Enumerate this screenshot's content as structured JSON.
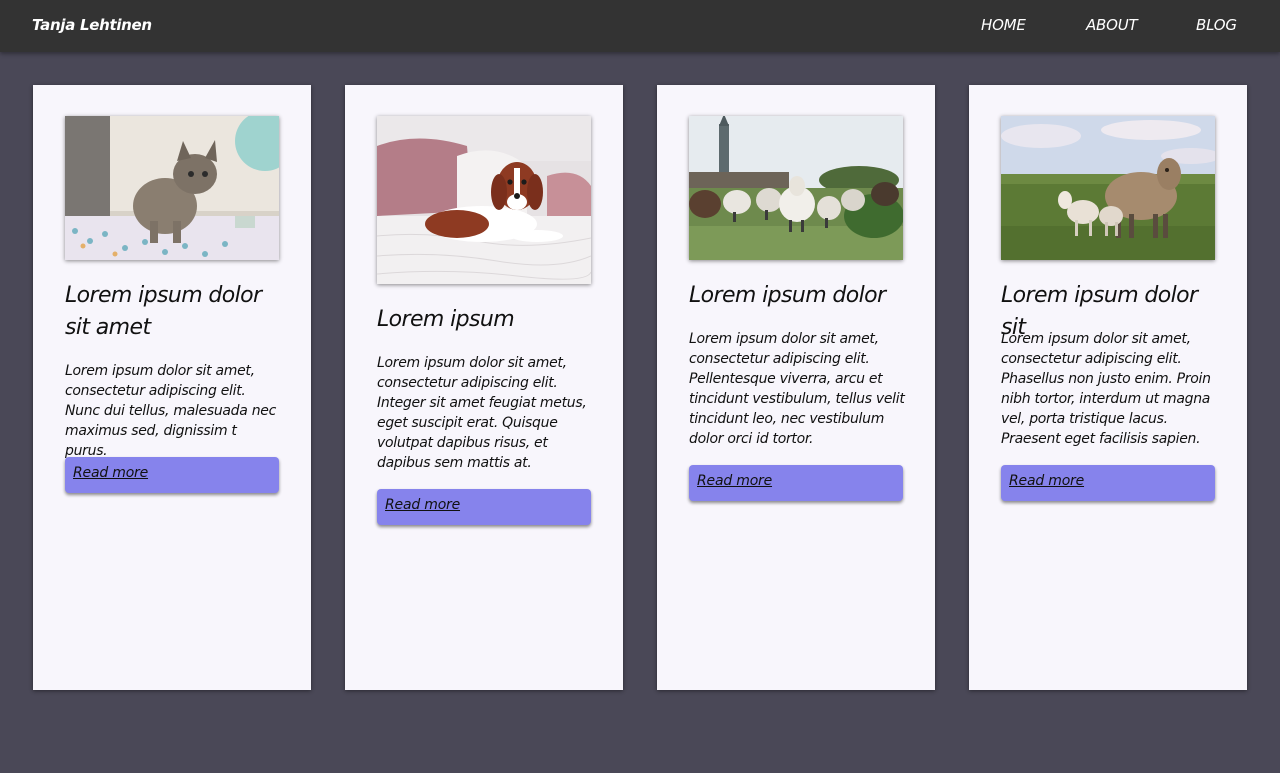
{
  "header": {
    "brand": "Tanja Lehtinen",
    "nav": [
      "HOME",
      "ABOUT",
      "BLOG"
    ]
  },
  "cards": [
    {
      "image": "kitten-photo",
      "title": "Lorem ipsum dolor sit amet",
      "text": "Lorem ipsum dolor sit amet, consectetur adipiscing elit. Nunc dui tellus, malesuada nec maximus sed, dignissim t purus.",
      "button": "Read more"
    },
    {
      "image": "dog-photo",
      "title": "Lorem ipsum",
      "text": "Lorem ipsum dolor sit amet, consectetur adipiscing elit. Integer sit amet feugiat metus, eget suscipit erat. Quisque volutpat dapibus risus, et dapibus sem mattis at.",
      "button": "Read more"
    },
    {
      "image": "sheep-flock-photo",
      "title": "Lorem ipsum dolor",
      "text": "Lorem ipsum dolor sit amet, consectetur adipiscing elit. Pellentesque viverra, arcu et tincidunt vestibulum, tellus velit tincidunt leo, nec vestibulum dolor orci id tortor.",
      "button": "Read more"
    },
    {
      "image": "sheep-lambs-photo",
      "title": "Lorem ipsum dolor sit",
      "text": "Lorem ipsum dolor sit amet, consectetur adipiscing elit. Phasellus non justo enim. Proin nibh tortor, interdum ut magna vel, porta tristique lacus. Praesent eget facilisis sapien.",
      "button": "Read more"
    }
  ],
  "colors": {
    "page_background": "#4a4857",
    "header_background": "#333333",
    "card_background": "#f8f6fc",
    "button_background": "#8683ec"
  }
}
